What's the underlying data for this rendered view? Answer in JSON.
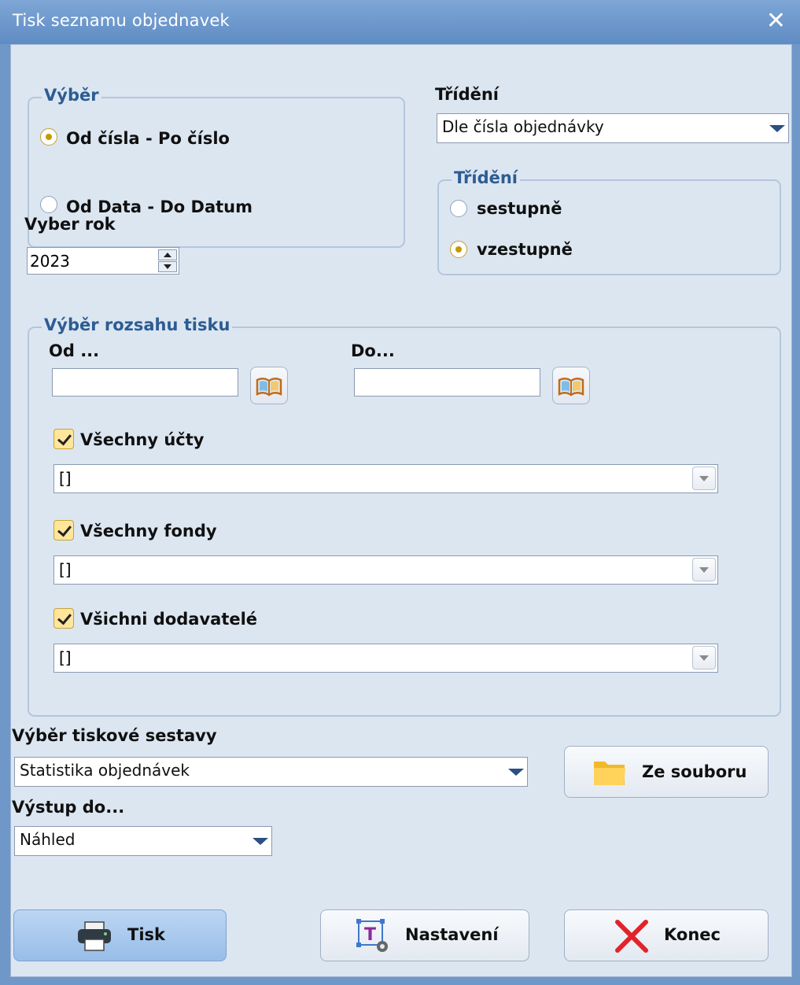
{
  "window": {
    "title": "Tisk seznamu objednavek",
    "close_icon": "close-icon"
  },
  "vyber_group": {
    "legend": "Výběr",
    "options": [
      {
        "label": "Od čísla - Po číslo",
        "selected": true
      },
      {
        "label": "Od Data - Do Datum",
        "selected": false
      }
    ]
  },
  "year": {
    "label": "Vyber rok",
    "value": "2023"
  },
  "sort": {
    "label": "Třídění",
    "selected": "Dle čísla objednávky"
  },
  "sort_order_group": {
    "legend": "Třídění",
    "options": [
      {
        "label": "sestupně",
        "selected": false
      },
      {
        "label": "vzestupně",
        "selected": true
      }
    ]
  },
  "range_group": {
    "legend": "Výběr rozsahu tisku",
    "from_label": "Od ...",
    "to_label": "Do...",
    "from_value": "",
    "to_value": "",
    "all_accounts": {
      "label": "Všechny účty",
      "checked": true,
      "combo_value": "[]"
    },
    "all_funds": {
      "label": "Všechny fondy",
      "checked": true,
      "combo_value": "[]"
    },
    "all_suppliers": {
      "label": "Všichni dodavatelé",
      "checked": true,
      "combo_value": "[]"
    }
  },
  "report": {
    "label": "Výběr tiskové sestavy",
    "selected": "Statistika objednávek",
    "from_file_button": "Ze souboru"
  },
  "output": {
    "label": "Výstup do...",
    "selected": "Náhled"
  },
  "buttons": {
    "print": "Tisk",
    "settings": "Nastavení",
    "exit": "Konec"
  }
}
